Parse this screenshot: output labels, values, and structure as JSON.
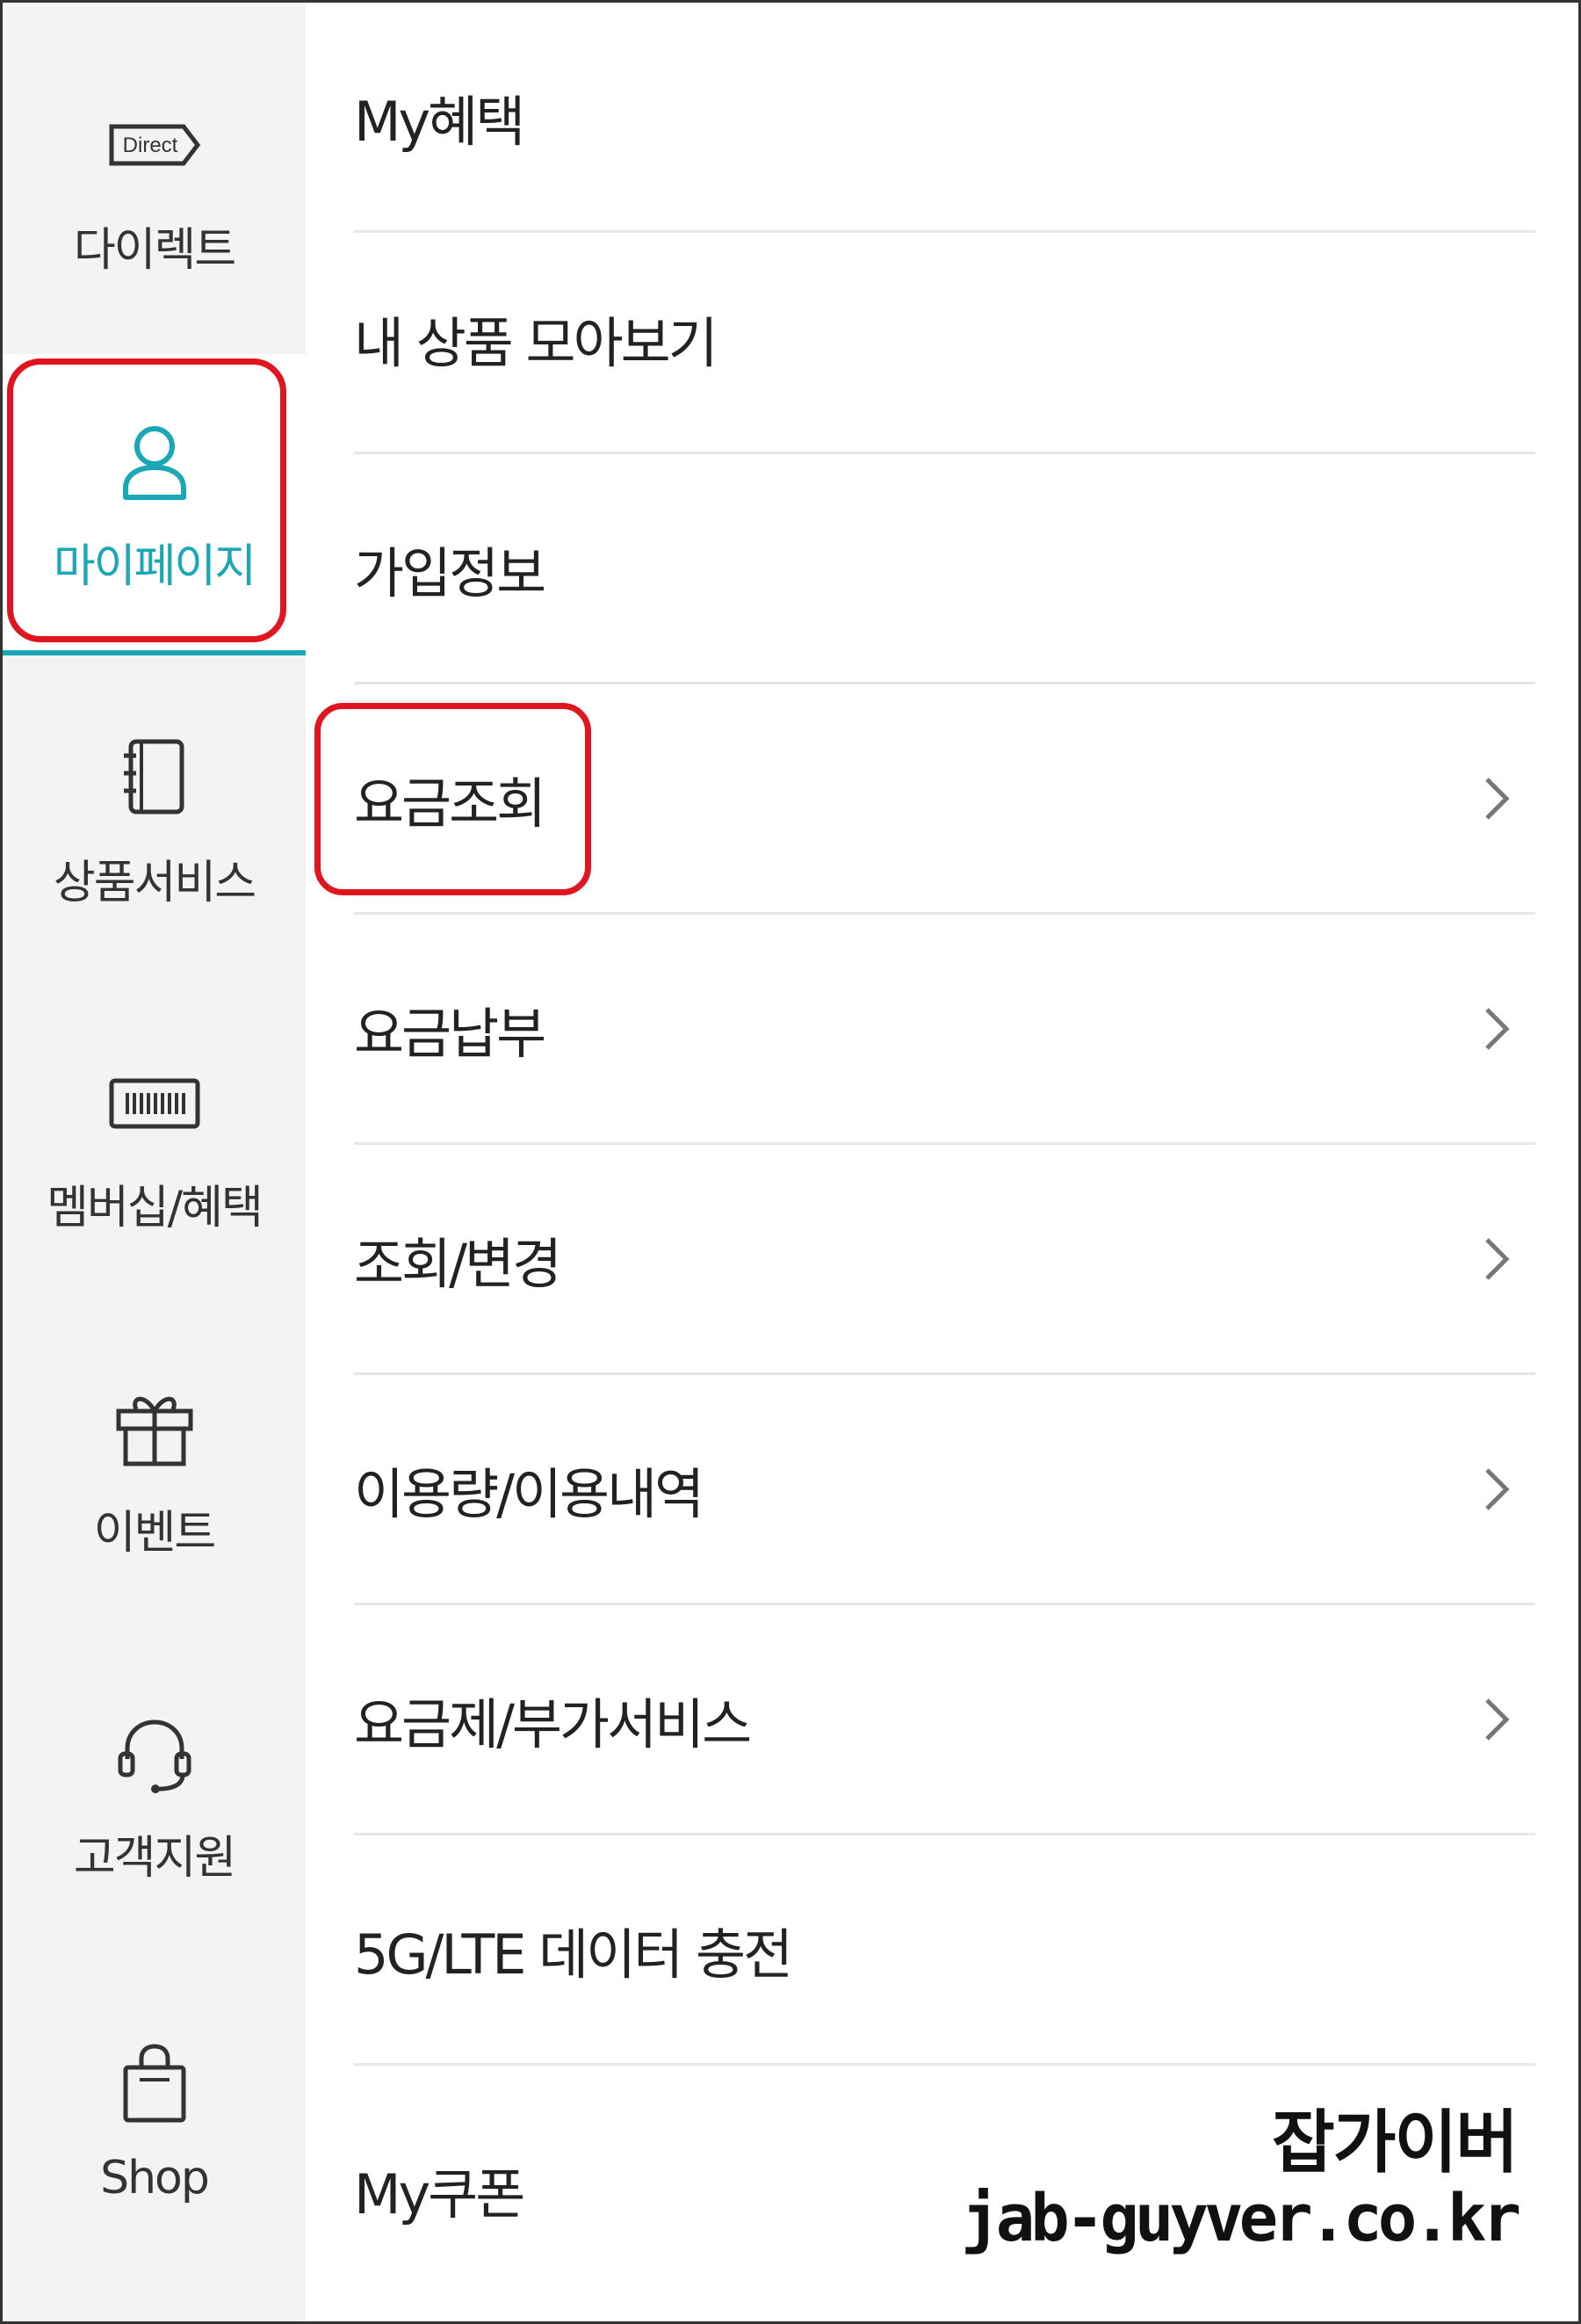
{
  "sidebar": {
    "items": [
      {
        "label": "다이렉트",
        "icon": "direct-tag-icon",
        "badge": "Direct"
      },
      {
        "label": "마이페이지",
        "icon": "person-icon"
      },
      {
        "label": "상품서비스",
        "icon": "notebook-icon"
      },
      {
        "label": "멤버십/혜택",
        "icon": "barcode-card-icon"
      },
      {
        "label": "이벤트",
        "icon": "gift-icon"
      },
      {
        "label": "고객지원",
        "icon": "headset-icon"
      },
      {
        "label": "Shop",
        "icon": "shopping-bag-icon"
      }
    ],
    "active_index": 1
  },
  "menu": {
    "items": [
      {
        "label": "My혜택",
        "has_chevron": false
      },
      {
        "label": "내 상품 모아보기",
        "has_chevron": false
      },
      {
        "label": "가입정보",
        "has_chevron": false
      },
      {
        "label": "요금조회",
        "has_chevron": true
      },
      {
        "label": "요금납부",
        "has_chevron": true
      },
      {
        "label": "조회/변경",
        "has_chevron": true
      },
      {
        "label": "이용량/이용내역",
        "has_chevron": true
      },
      {
        "label": "요금제/부가서비스",
        "has_chevron": true
      },
      {
        "label": "5G/LTE 데이터 충전",
        "has_chevron": false
      },
      {
        "label": "My쿠폰",
        "has_chevron": false
      }
    ]
  },
  "annotations": {
    "highlight_color": "#e0151f"
  },
  "theme": {
    "accent": "#1aa8b6",
    "sidebar_bg": "#f3f3f3"
  },
  "watermark": {
    "line1": "잡가이버",
    "line2": "jab-guyver.co.kr"
  }
}
